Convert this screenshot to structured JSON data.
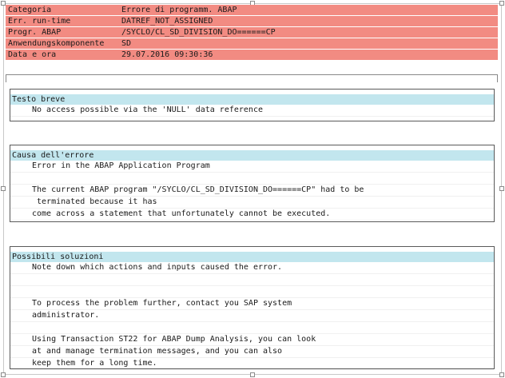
{
  "header": [
    {
      "key": "Categoria",
      "value": "Errore di programm. ABAP"
    },
    {
      "key": "Err. run-time",
      "value": "DATREF_NOT_ASSIGNED"
    },
    {
      "key": "Progr. ABAP",
      "value": "/SYCLO/CL_SD_DIVISION_DO======CP"
    },
    {
      "key": "Anwendungskomponente",
      "value": "SD"
    },
    {
      "key": "Data e ora",
      "value": "29.07.2016 09:30:36"
    }
  ],
  "short_text": {
    "title": "Testo breve",
    "lines": [
      "No access possible via the 'NULL' data reference"
    ]
  },
  "cause": {
    "title": "Causa dell'errore",
    "lines": [
      "Error in the ABAP Application Program",
      "",
      "The current ABAP program \"/SYCLO/CL_SD_DIVISION_DO======CP\" had to be",
      " terminated because it has",
      "come across a statement that unfortunately cannot be executed."
    ]
  },
  "solutions": {
    "title": "Possibili soluzioni",
    "lines": [
      "Note down which actions and inputs caused the error.",
      "",
      "",
      "To process the problem further, contact you SAP system",
      "administrator.",
      "",
      "Using Transaction ST22 for ABAP Dump Analysis, you can look",
      "at and manage termination messages, and you can also",
      "keep them for a long time."
    ]
  },
  "colors": {
    "header_bg": "#f28b82",
    "section_title_bg": "#c2e6ee"
  }
}
